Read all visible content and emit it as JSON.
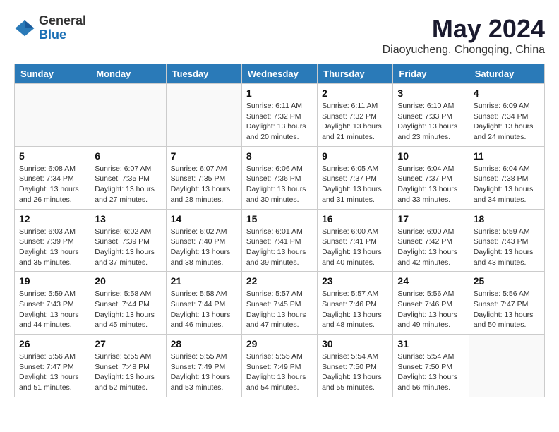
{
  "header": {
    "logo": {
      "general": "General",
      "blue": "Blue"
    },
    "title": "May 2024",
    "location": "Diaoyucheng, Chongqing, China"
  },
  "weekdays": [
    "Sunday",
    "Monday",
    "Tuesday",
    "Wednesday",
    "Thursday",
    "Friday",
    "Saturday"
  ],
  "weeks": [
    [
      {
        "day": "",
        "sunrise": "",
        "sunset": "",
        "daylight": ""
      },
      {
        "day": "",
        "sunrise": "",
        "sunset": "",
        "daylight": ""
      },
      {
        "day": "",
        "sunrise": "",
        "sunset": "",
        "daylight": ""
      },
      {
        "day": "1",
        "sunrise": "Sunrise: 6:11 AM",
        "sunset": "Sunset: 7:32 PM",
        "daylight": "Daylight: 13 hours and 20 minutes."
      },
      {
        "day": "2",
        "sunrise": "Sunrise: 6:11 AM",
        "sunset": "Sunset: 7:32 PM",
        "daylight": "Daylight: 13 hours and 21 minutes."
      },
      {
        "day": "3",
        "sunrise": "Sunrise: 6:10 AM",
        "sunset": "Sunset: 7:33 PM",
        "daylight": "Daylight: 13 hours and 23 minutes."
      },
      {
        "day": "4",
        "sunrise": "Sunrise: 6:09 AM",
        "sunset": "Sunset: 7:34 PM",
        "daylight": "Daylight: 13 hours and 24 minutes."
      }
    ],
    [
      {
        "day": "5",
        "sunrise": "Sunrise: 6:08 AM",
        "sunset": "Sunset: 7:34 PM",
        "daylight": "Daylight: 13 hours and 26 minutes."
      },
      {
        "day": "6",
        "sunrise": "Sunrise: 6:07 AM",
        "sunset": "Sunset: 7:35 PM",
        "daylight": "Daylight: 13 hours and 27 minutes."
      },
      {
        "day": "7",
        "sunrise": "Sunrise: 6:07 AM",
        "sunset": "Sunset: 7:35 PM",
        "daylight": "Daylight: 13 hours and 28 minutes."
      },
      {
        "day": "8",
        "sunrise": "Sunrise: 6:06 AM",
        "sunset": "Sunset: 7:36 PM",
        "daylight": "Daylight: 13 hours and 30 minutes."
      },
      {
        "day": "9",
        "sunrise": "Sunrise: 6:05 AM",
        "sunset": "Sunset: 7:37 PM",
        "daylight": "Daylight: 13 hours and 31 minutes."
      },
      {
        "day": "10",
        "sunrise": "Sunrise: 6:04 AM",
        "sunset": "Sunset: 7:37 PM",
        "daylight": "Daylight: 13 hours and 33 minutes."
      },
      {
        "day": "11",
        "sunrise": "Sunrise: 6:04 AM",
        "sunset": "Sunset: 7:38 PM",
        "daylight": "Daylight: 13 hours and 34 minutes."
      }
    ],
    [
      {
        "day": "12",
        "sunrise": "Sunrise: 6:03 AM",
        "sunset": "Sunset: 7:39 PM",
        "daylight": "Daylight: 13 hours and 35 minutes."
      },
      {
        "day": "13",
        "sunrise": "Sunrise: 6:02 AM",
        "sunset": "Sunset: 7:39 PM",
        "daylight": "Daylight: 13 hours and 37 minutes."
      },
      {
        "day": "14",
        "sunrise": "Sunrise: 6:02 AM",
        "sunset": "Sunset: 7:40 PM",
        "daylight": "Daylight: 13 hours and 38 minutes."
      },
      {
        "day": "15",
        "sunrise": "Sunrise: 6:01 AM",
        "sunset": "Sunset: 7:41 PM",
        "daylight": "Daylight: 13 hours and 39 minutes."
      },
      {
        "day": "16",
        "sunrise": "Sunrise: 6:00 AM",
        "sunset": "Sunset: 7:41 PM",
        "daylight": "Daylight: 13 hours and 40 minutes."
      },
      {
        "day": "17",
        "sunrise": "Sunrise: 6:00 AM",
        "sunset": "Sunset: 7:42 PM",
        "daylight": "Daylight: 13 hours and 42 minutes."
      },
      {
        "day": "18",
        "sunrise": "Sunrise: 5:59 AM",
        "sunset": "Sunset: 7:43 PM",
        "daylight": "Daylight: 13 hours and 43 minutes."
      }
    ],
    [
      {
        "day": "19",
        "sunrise": "Sunrise: 5:59 AM",
        "sunset": "Sunset: 7:43 PM",
        "daylight": "Daylight: 13 hours and 44 minutes."
      },
      {
        "day": "20",
        "sunrise": "Sunrise: 5:58 AM",
        "sunset": "Sunset: 7:44 PM",
        "daylight": "Daylight: 13 hours and 45 minutes."
      },
      {
        "day": "21",
        "sunrise": "Sunrise: 5:58 AM",
        "sunset": "Sunset: 7:44 PM",
        "daylight": "Daylight: 13 hours and 46 minutes."
      },
      {
        "day": "22",
        "sunrise": "Sunrise: 5:57 AM",
        "sunset": "Sunset: 7:45 PM",
        "daylight": "Daylight: 13 hours and 47 minutes."
      },
      {
        "day": "23",
        "sunrise": "Sunrise: 5:57 AM",
        "sunset": "Sunset: 7:46 PM",
        "daylight": "Daylight: 13 hours and 48 minutes."
      },
      {
        "day": "24",
        "sunrise": "Sunrise: 5:56 AM",
        "sunset": "Sunset: 7:46 PM",
        "daylight": "Daylight: 13 hours and 49 minutes."
      },
      {
        "day": "25",
        "sunrise": "Sunrise: 5:56 AM",
        "sunset": "Sunset: 7:47 PM",
        "daylight": "Daylight: 13 hours and 50 minutes."
      }
    ],
    [
      {
        "day": "26",
        "sunrise": "Sunrise: 5:56 AM",
        "sunset": "Sunset: 7:47 PM",
        "daylight": "Daylight: 13 hours and 51 minutes."
      },
      {
        "day": "27",
        "sunrise": "Sunrise: 5:55 AM",
        "sunset": "Sunset: 7:48 PM",
        "daylight": "Daylight: 13 hours and 52 minutes."
      },
      {
        "day": "28",
        "sunrise": "Sunrise: 5:55 AM",
        "sunset": "Sunset: 7:49 PM",
        "daylight": "Daylight: 13 hours and 53 minutes."
      },
      {
        "day": "29",
        "sunrise": "Sunrise: 5:55 AM",
        "sunset": "Sunset: 7:49 PM",
        "daylight": "Daylight: 13 hours and 54 minutes."
      },
      {
        "day": "30",
        "sunrise": "Sunrise: 5:54 AM",
        "sunset": "Sunset: 7:50 PM",
        "daylight": "Daylight: 13 hours and 55 minutes."
      },
      {
        "day": "31",
        "sunrise": "Sunrise: 5:54 AM",
        "sunset": "Sunset: 7:50 PM",
        "daylight": "Daylight: 13 hours and 56 minutes."
      },
      {
        "day": "",
        "sunrise": "",
        "sunset": "",
        "daylight": ""
      }
    ]
  ]
}
